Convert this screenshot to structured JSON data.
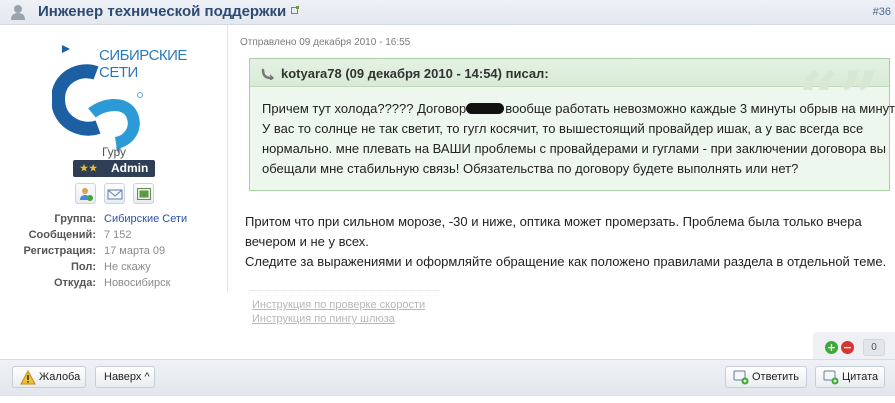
{
  "header": {
    "title": "Инженер технической поддержки",
    "post_number": "#36"
  },
  "author": {
    "logo_lines": [
      "СИБИРСКИЕ",
      "СЕТИ"
    ],
    "rank": "Гуру",
    "badge": "Admin",
    "info": [
      {
        "key": "Группа:",
        "value": "Сибирские Сети",
        "link": true
      },
      {
        "key": "Сообщений:",
        "value": "7 152",
        "link": false
      },
      {
        "key": "Регистрация:",
        "value": "17 марта 09",
        "link": false
      },
      {
        "key": "Пол:",
        "value": "Не скажу",
        "link": false
      },
      {
        "key": "Откуда:",
        "value": "Новосибирск",
        "link": false
      }
    ]
  },
  "post": {
    "sent": "Отправлено 09 декабря 2010 - 16:55",
    "quote": {
      "author": "kotyara78 (09 декабря 2010 - 14:54) писал:",
      "line1_a": "Причем тут холода????? Договор",
      "line1_b": "вообще работать невозможно каждые 3 минуты обрыв на минуту.",
      "line2": "У вас то солнце не так светит, то гугл косячит, то вышестоящий провайдер ишак, а у вас всегда все",
      "line3": "нормально. мне плевать на ВАШИ проблемы с провайдерами и гуглами - при заключении договора вы",
      "line4": "обещали мне стабильную связь! Обязательства по договору будете выполнять или нет?"
    },
    "text_lines": [
      "Притом что при сильном морозе, -30 и ниже, оптика может промерзать. Проблема была только вчера",
      "вечером и не у всех.",
      "Следите за выражениями и оформляйте обращение как положено правилами раздела в отдельной теме."
    ],
    "signature_links": [
      "Инструкция по проверке скорости",
      "Инструкция по пингу шлюза"
    ]
  },
  "rating": {
    "plus": "+",
    "minus": "−",
    "count": "0"
  },
  "footer": {
    "report": "Жалоба",
    "top": "Наверх ^",
    "reply": "Ответить",
    "quote": "Цитата"
  },
  "colors": {
    "title": "#2d4b73",
    "link": "#2a52a8",
    "quote_bg": "#eef7ee",
    "quote_border": "#a9d0a5",
    "badge_bg": "#2e3f55"
  }
}
